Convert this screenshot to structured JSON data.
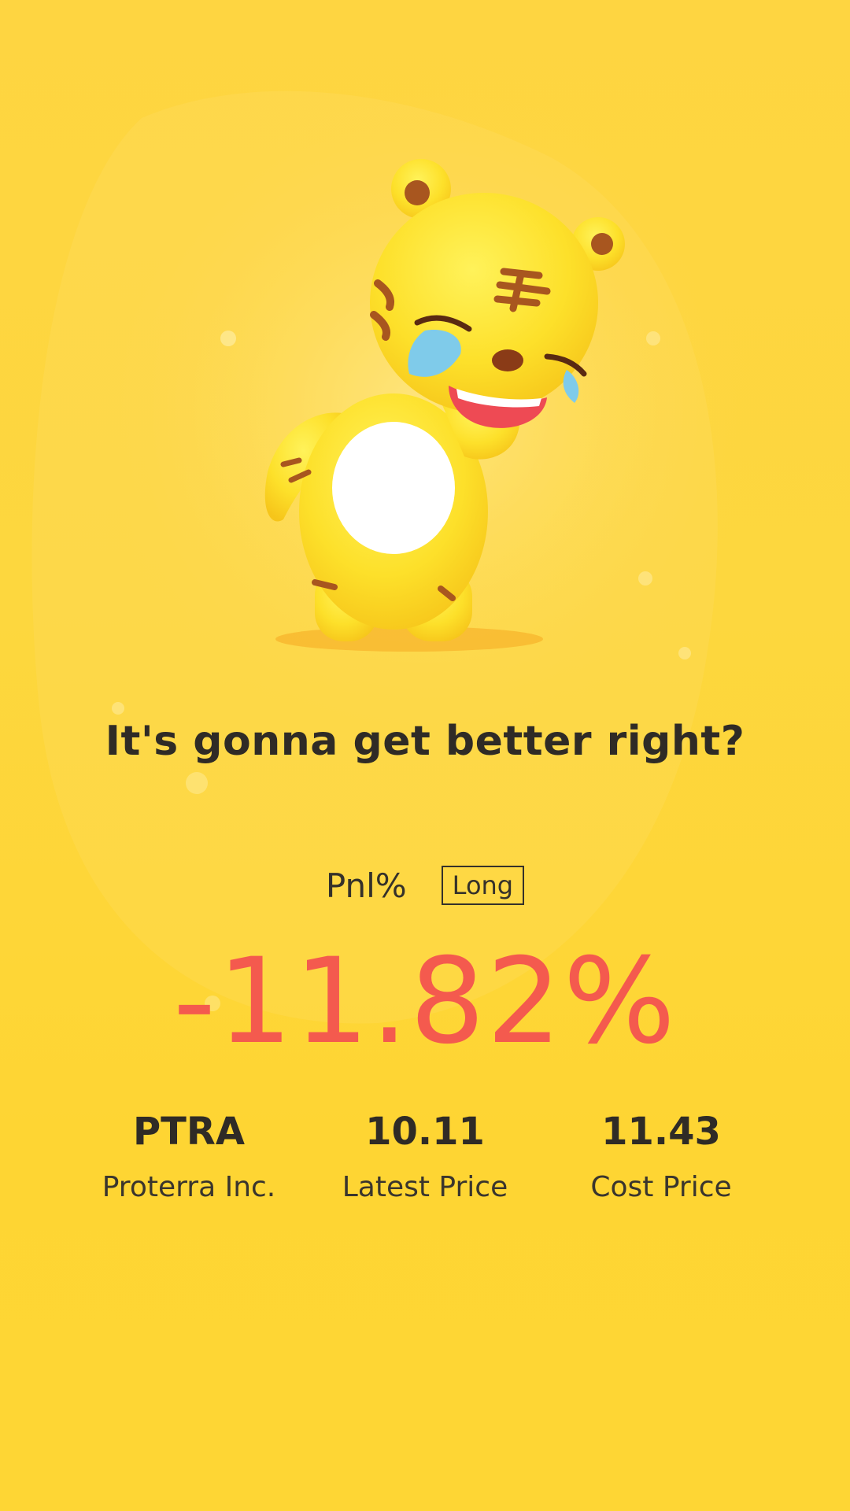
{
  "message": "It's gonna get better right?",
  "pnl": {
    "label": "Pnl%",
    "position": "Long",
    "value": "-11.82%"
  },
  "stats": [
    {
      "value": "PTRA",
      "label": "Proterra Inc."
    },
    {
      "value": "10.11",
      "label": "Latest Price"
    },
    {
      "value": "11.43",
      "label": "Cost Price"
    }
  ],
  "colors": {
    "background": "#fed541",
    "loss": "#f45a4e",
    "text": "#2f2b26"
  }
}
